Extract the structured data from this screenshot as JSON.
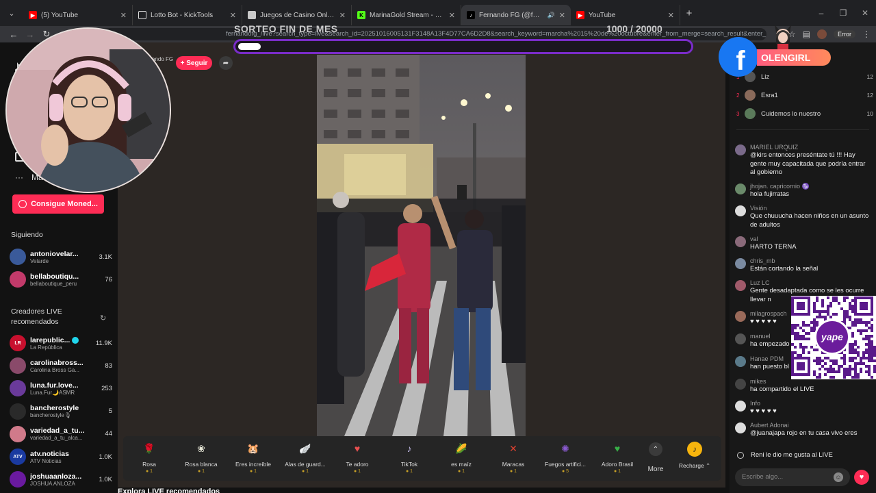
{
  "tabs": [
    {
      "title": "(5) YouTube",
      "icon": "youtube-icon",
      "color": "#ff0000"
    },
    {
      "title": "Lotto Bot - KickTools",
      "icon": "kicktools-icon",
      "color": "#ffffff"
    },
    {
      "title": "Juegos de Casino Online | Apu",
      "icon": "casino-icon",
      "color": "#c9c9c9"
    },
    {
      "title": "MarinaGold Stream - Watch Liv",
      "icon": "kick-icon",
      "color": "#53fc18"
    },
    {
      "title": "Fernando FG (@fernandofg",
      "icon": "tiktok-icon",
      "color": "#000000",
      "active": true
    },
    {
      "title": "YouTube",
      "icon": "youtube-icon",
      "color": "#ff0000"
    }
  ],
  "url": "fernandofg_/live?search_type=live&search_id=20251016005131F3148A13F4D77CA6D2D8&search_keyword=marcha%2015%20de%20octubre&enter_from_merge=search_result&enter_method=live_cell&search_result_id=75615995382",
  "toolbar": {
    "error_label": "Error"
  },
  "overlay": {
    "giveaway_title": "SORTEO FIN DE MES",
    "giveaway_count": "1000 / 20000",
    "giveaway_progress": 0.05,
    "brand_name": "OLENGIRL",
    "facebook_glyph": "f",
    "yape_label": "yape"
  },
  "sidebar": {
    "more_label": "Ma",
    "coins_button": "Consigue Moned...",
    "following_heading": "Siguiendo",
    "following": [
      {
        "name": "antonioveIar...",
        "sub": "Velarde",
        "count": "3.1K",
        "color": "#3a5a9a"
      },
      {
        "name": "bellaboutiqu...",
        "sub": "bellaboutique_peru",
        "count": "76",
        "color": "#c23a6a"
      }
    ],
    "creators_heading": "Creadores LIVE recomendados",
    "creators": [
      {
        "name": "larepublic...",
        "sub": "La República",
        "count": "11.9K",
        "color": "#c8102e",
        "initials": "LR",
        "verified": true
      },
      {
        "name": "carolinabross...",
        "sub": "Carolina Bross Ga...",
        "count": "83",
        "color": "#8a4a6a",
        "initials": ""
      },
      {
        "name": "luna.fur.love...",
        "sub": "Luna.Fur🌙ASMR",
        "count": "253",
        "color": "#6a3a9a",
        "initials": ""
      },
      {
        "name": "bancherostyle",
        "sub": "bancherostyle🎙",
        "count": "5",
        "color": "#2a2a2a",
        "initials": ""
      },
      {
        "name": "variedad_a_tu...",
        "sub": "variedad_a_tu_alca...",
        "count": "44",
        "color": "#d07a8a",
        "initials": ""
      },
      {
        "name": "atv.noticias",
        "sub": "ATV Noticias",
        "count": "1.0K",
        "color": "#1a3aa0",
        "initials": "ATV"
      },
      {
        "name": "joshuaanloza...",
        "sub": "JOSHUA ANLOZA",
        "count": "1.0K",
        "color": "#6a1aa0",
        "initials": ""
      }
    ],
    "bottom_text": "Explora LIVE recomendados"
  },
  "stream": {
    "host_name": "ando FG",
    "follow_label": "+ Seguir"
  },
  "gifts": [
    {
      "name": "Rosa",
      "price": "1",
      "icon": "rose-icon",
      "glyph": "🌹",
      "color": "#b0202c"
    },
    {
      "name": "Rosa blanca",
      "price": "1",
      "icon": "white-rose-icon",
      "glyph": "❀",
      "color": "#e8e8d8"
    },
    {
      "name": "Eres increíble",
      "price": "1",
      "icon": "hamster-icon",
      "glyph": "🐹",
      "color": "#c58b4a"
    },
    {
      "name": "Alas de guard...",
      "price": "1",
      "icon": "wings-icon",
      "glyph": "🪽",
      "color": "#8ab8e8"
    },
    {
      "name": "Te adoro",
      "price": "1",
      "icon": "heart-gift-icon",
      "glyph": "♥",
      "color": "#e85050"
    },
    {
      "name": "TikTok",
      "price": "1",
      "icon": "tiktok-gift-icon",
      "glyph": "♪",
      "color": "#c8c0f0"
    },
    {
      "name": "es maíz",
      "price": "1",
      "icon": "corn-icon",
      "glyph": "🌽",
      "color": "#f0c020"
    },
    {
      "name": "Maracas",
      "price": "1",
      "icon": "maracas-icon",
      "glyph": "✕",
      "color": "#d84030"
    },
    {
      "name": "Fuegos artifici...",
      "price": "5",
      "icon": "fireworks-icon",
      "glyph": "✺",
      "color": "#8a5ad0"
    },
    {
      "name": "Adoro Brasil",
      "price": "1",
      "icon": "brazil-heart-icon",
      "glyph": "♥",
      "color": "#38b048"
    }
  ],
  "gift_more_label": "More",
  "recharge_label": "Recharge",
  "ranking": [
    {
      "rank": "1",
      "name": "Liz",
      "score": "12",
      "color": "#555"
    },
    {
      "rank": "2",
      "name": "Esra1",
      "score": "12",
      "color": "#8a6a5a"
    },
    {
      "rank": "3",
      "name": "Cuidemos lo nuestro",
      "score": "10",
      "color": "#5a7a5a"
    }
  ],
  "comments": [
    {
      "user": "MARIEL URQUIZ",
      "text": "@kirs entonces preséntate tú !!! Hay gente muy capacitada que podría entrar al gobierno",
      "color": "#7a6a8a"
    },
    {
      "user": "jhojan. capricornio ♑",
      "text": "hola fujirratas",
      "color": "#6a8a6a"
    },
    {
      "user": "Visión",
      "text": "Que chuuucha hacen niños en un asunto de adultos",
      "color": "#dddddd"
    },
    {
      "user": "val",
      "text": "HARTO TERNA",
      "color": "#8a6a7a"
    },
    {
      "user": "chris_mb",
      "text": "Están cortando la señal",
      "color": "#7a8aa0"
    },
    {
      "user": "Luz LC",
      "text": "Gente desadaptada como se les ocurre llevar n",
      "color": "#a05a6a"
    },
    {
      "user": "milagrospach",
      "text": "♥ ♥ ♥ ♥ ♥",
      "color": "#9a6a5a"
    },
    {
      "user": "manuel",
      "text": "ha empezado",
      "color": "#555555"
    },
    {
      "user": "Hanae PDM",
      "text": "han puesto bl",
      "color": "#5a7a8a"
    },
    {
      "user": "mikes",
      "text": "ha compartido el LIVE",
      "color": "#444444"
    },
    {
      "user": "Info",
      "text": "♥ ♥ ♥ ♥ ♥",
      "color": "#dddddd"
    },
    {
      "user": "Aubert Adonai",
      "text": "@juanajapa rojo en tu casa vivo eres",
      "color": "#dddddd"
    },
    {
      "user": "",
      "text": "Reni le dio me gusta al LIVE",
      "color": "#181818"
    }
  ],
  "chat_placeholder": "Escribe algo..."
}
